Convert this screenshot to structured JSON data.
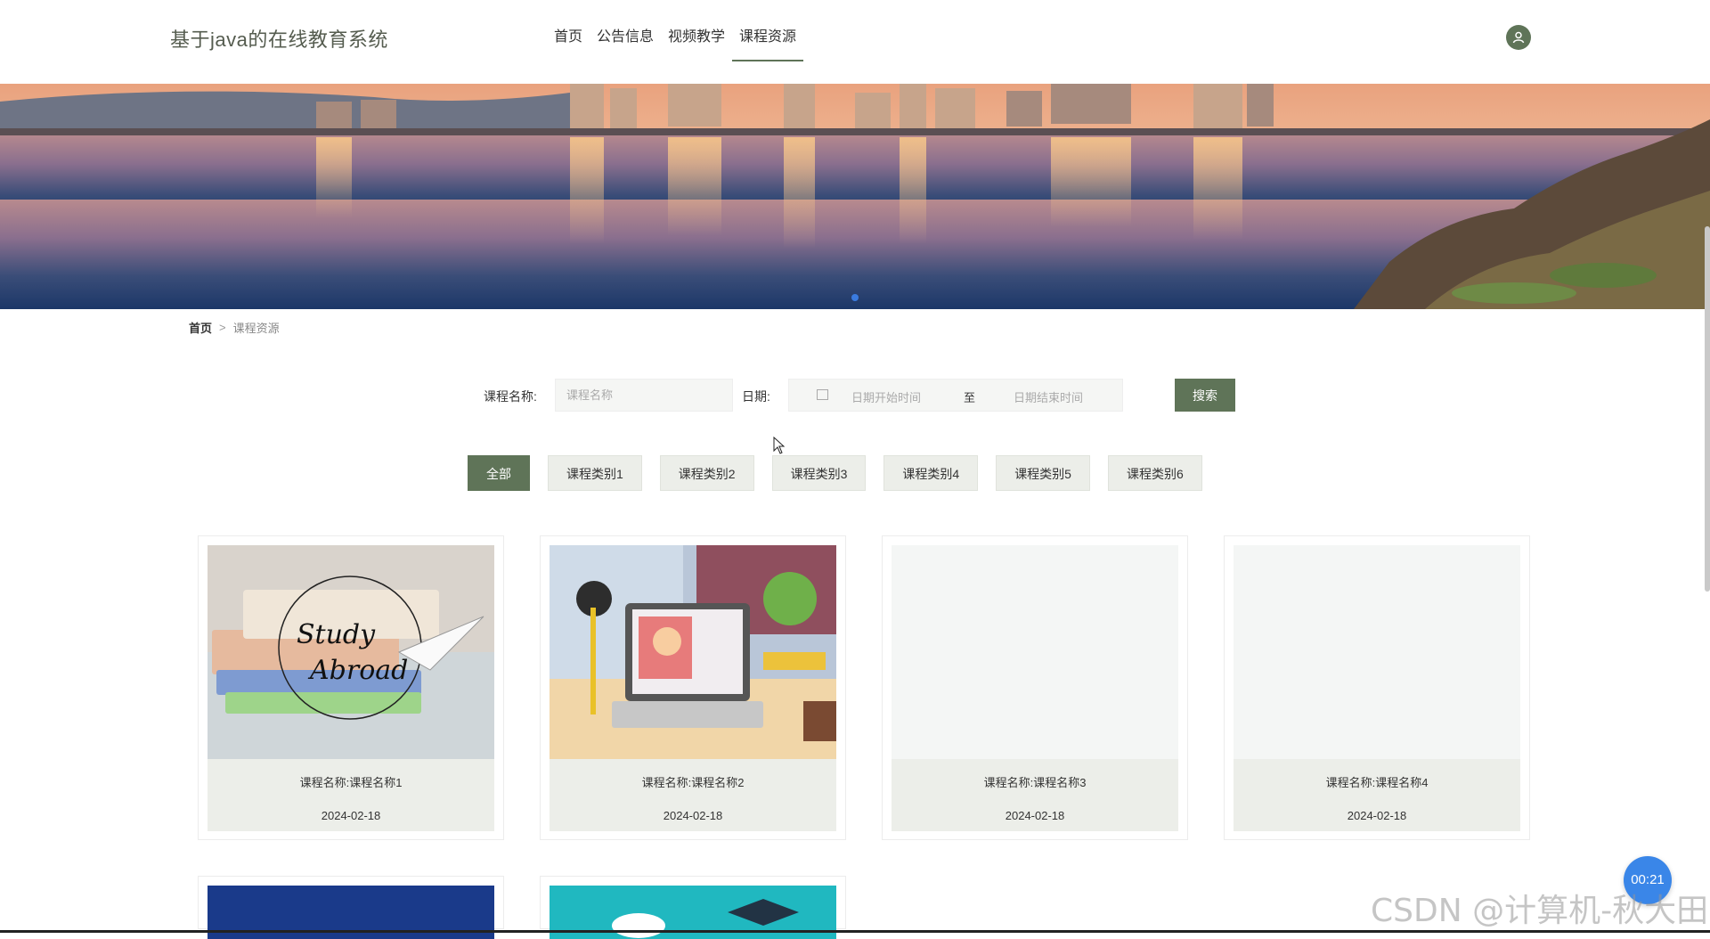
{
  "header": {
    "site_title": "基于java的在线教育系统",
    "nav": [
      {
        "label": "首页"
      },
      {
        "label": "公告信息"
      },
      {
        "label": "视频教学"
      },
      {
        "label": "课程资源",
        "active": true
      }
    ],
    "accent_color": "#5f7458",
    "user_icon": "user-icon"
  },
  "breadcrumb": {
    "home": "首页",
    "separator": ">",
    "current": "课程资源"
  },
  "search": {
    "name_label": "课程名称:",
    "name_placeholder": "课程名称",
    "date_label": "日期:",
    "date_start_placeholder": "日期开始时间",
    "date_separator": "至",
    "date_end_placeholder": "日期结束时间",
    "button": "搜索"
  },
  "categories": [
    "全部",
    "课程类别1",
    "课程类别2",
    "课程类别3",
    "课程类别4",
    "课程类别5",
    "课程类别6"
  ],
  "courses": [
    {
      "name": "课程名称:课程名称1",
      "date": "2024-02-18"
    },
    {
      "name": "课程名称:课程名称2",
      "date": "2024-02-18"
    },
    {
      "name": "课程名称:课程名称3",
      "date": "2024-02-18"
    },
    {
      "name": "课程名称:课程名称4",
      "date": "2024-02-18"
    }
  ],
  "timer": "00:21",
  "watermark": "CSDN @计算机-秋大田"
}
